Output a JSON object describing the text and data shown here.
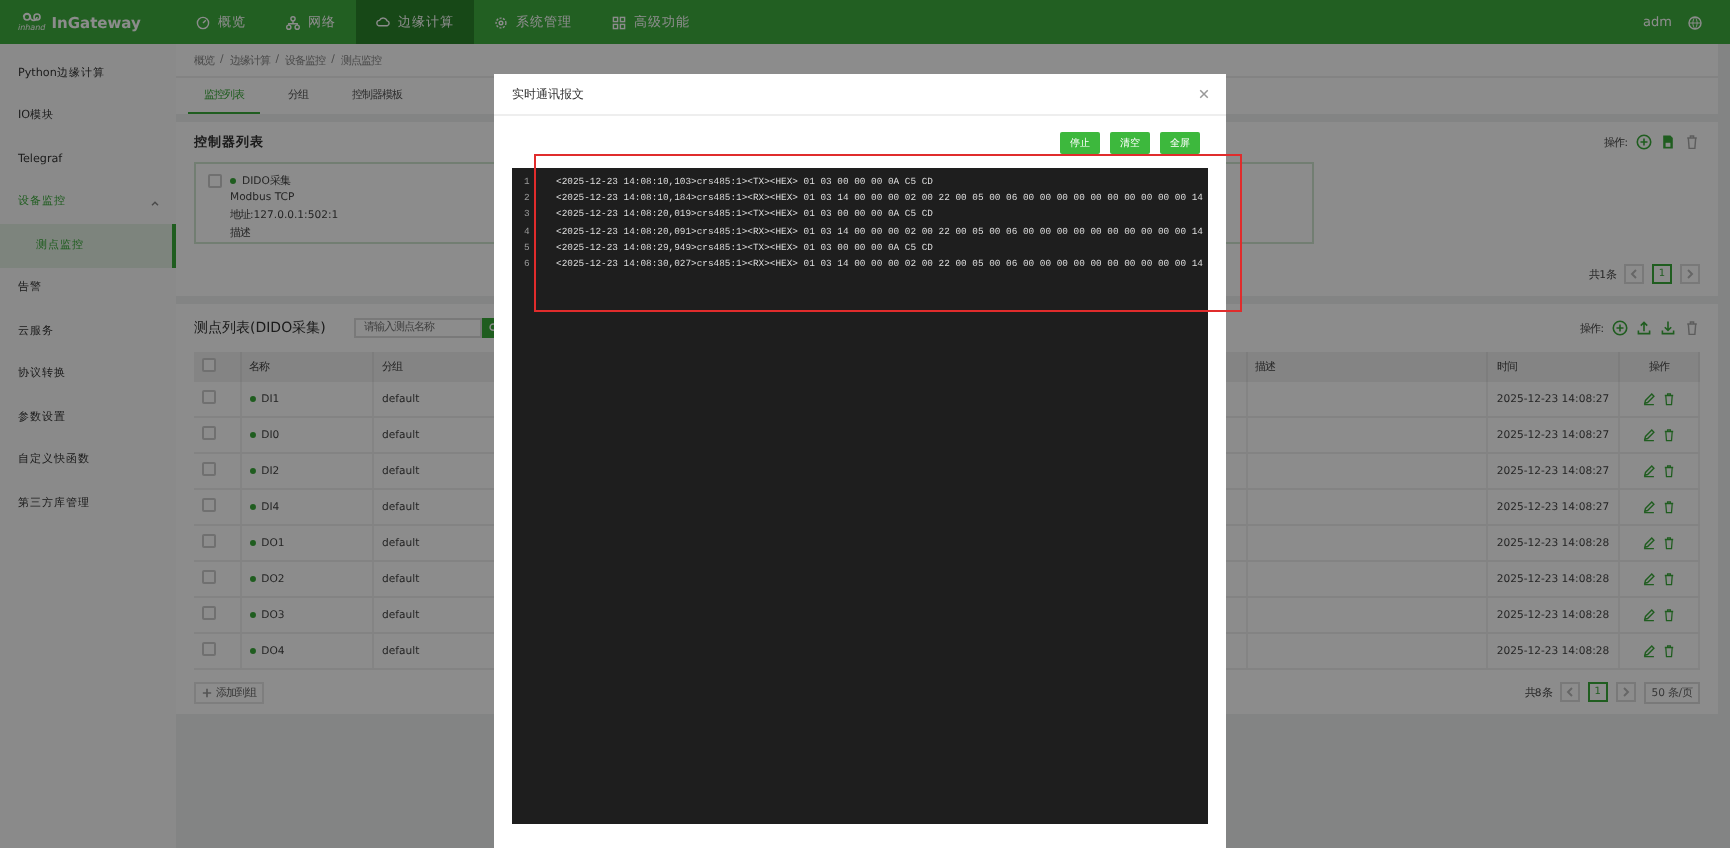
{
  "header": {
    "logo_small": "inhand",
    "logo": "InGateway",
    "nav": [
      {
        "label": "概览",
        "selected": false
      },
      {
        "label": "网络",
        "selected": false
      },
      {
        "label": "边缘计算",
        "selected": true
      },
      {
        "label": "系统管理",
        "selected": false
      },
      {
        "label": "高级功能",
        "selected": false
      }
    ],
    "user": "adm"
  },
  "sidebar": {
    "items": [
      {
        "label": "Python边缘计算",
        "selected": false
      },
      {
        "label": "IO模块",
        "selected": false
      },
      {
        "label": "Telegraf",
        "selected": false
      },
      {
        "label": "设备监控",
        "selected": false,
        "expanded": true,
        "children": [
          {
            "label": "测点监控",
            "selected": true
          }
        ]
      },
      {
        "label": "告警",
        "selected": false
      },
      {
        "label": "云服务",
        "selected": false
      },
      {
        "label": "协议转换",
        "selected": false
      },
      {
        "label": "参数设置",
        "selected": false
      },
      {
        "label": "自定义快函数",
        "selected": false
      },
      {
        "label": "第三方库管理",
        "selected": false
      }
    ]
  },
  "breadcrumb": {
    "separator": "/",
    "items": [
      "概览",
      "边缘计算",
      "设备监控",
      "测点监控"
    ]
  },
  "tabs": [
    {
      "label": "监控列表",
      "selected": true
    },
    {
      "label": "分组",
      "selected": false
    },
    {
      "label": "控制器模板",
      "selected": false
    }
  ],
  "controllers": {
    "title": "控制器列表",
    "ops_label": "操作:",
    "cards": [
      {
        "name": "DIDO采集",
        "checked": false,
        "protocol": "Modbus TCP",
        "address": "地址:127.0.0.1:502:1",
        "description": "描述"
      }
    ],
    "total": "共1条",
    "pages": [
      {
        "label": "1",
        "selected": true
      }
    ]
  },
  "points": {
    "title": "测点列表(DIDO采集)",
    "search": {
      "placeholder": "请输入测点名称"
    },
    "ops_label": "操作:",
    "select_all_checked": false,
    "columns": [
      "名称",
      "分组",
      "描述",
      "时间",
      "操作"
    ],
    "rows": [
      {
        "checked": false,
        "name": "DI1",
        "group": "default",
        "time": "2025-12-23 14:08:27"
      },
      {
        "checked": false,
        "name": "DI0",
        "group": "default",
        "time": "2025-12-23 14:08:27"
      },
      {
        "checked": false,
        "name": "DI2",
        "group": "default",
        "time": "2025-12-23 14:08:27"
      },
      {
        "checked": false,
        "name": "DI4",
        "group": "default",
        "time": "2025-12-23 14:08:27"
      },
      {
        "checked": false,
        "name": "DO1",
        "group": "default",
        "time": "2025-12-23 14:08:28"
      },
      {
        "checked": false,
        "name": "DO2",
        "group": "default",
        "time": "2025-12-23 14:08:28"
      },
      {
        "checked": false,
        "name": "DO3",
        "group": "default",
        "time": "2025-12-23 14:08:28"
      },
      {
        "checked": false,
        "name": "DO4",
        "group": "default",
        "time": "2025-12-23 14:08:28"
      }
    ],
    "add_button": "添加到组",
    "total": "共8条",
    "pages": [
      {
        "label": "1",
        "selected": true
      }
    ],
    "page_size": "50 条/页"
  },
  "modal": {
    "title": "实时通讯报文",
    "buttons": [
      "停止",
      "清空",
      "全屏"
    ],
    "log": [
      {
        "line": "1",
        "text": "<2025-12-23 14:08:10,103>crs485:1><TX><HEX> 01 03 00 00 00 0A C5 CD"
      },
      {
        "line": "2",
        "text": "<2025-12-23 14:08:10,184>crs485:1><RX><HEX> 01 03 14 00 00 00 02 00 22 00 05 00 06 00 00 00 00 00 00 00 00 00 00 14"
      },
      {
        "line": "3",
        "text": "<2025-12-23 14:08:20,019>crs485:1><TX><HEX> 01 03 00 00 00 0A C5 CD"
      },
      {
        "line": "4",
        "text": "<2025-12-23 14:08:20,091>crs485:1><RX><HEX> 01 03 14 00 00 00 02 00 22 00 05 00 06 00 00 00 00 00 00 00 00 00 00 14"
      },
      {
        "line": "5",
        "text": "<2025-12-23 14:08:29,949>crs485:1><TX><HEX> 01 03 00 00 00 0A C5 CD"
      },
      {
        "line": "6",
        "text": "<2025-12-23 14:08:30,027>crs485:1><RX><HEX> 01 03 14 00 00 00 02 00 22 00 05 00 06 00 00 00 00 00 00 00 00 00 00 14"
      }
    ]
  }
}
